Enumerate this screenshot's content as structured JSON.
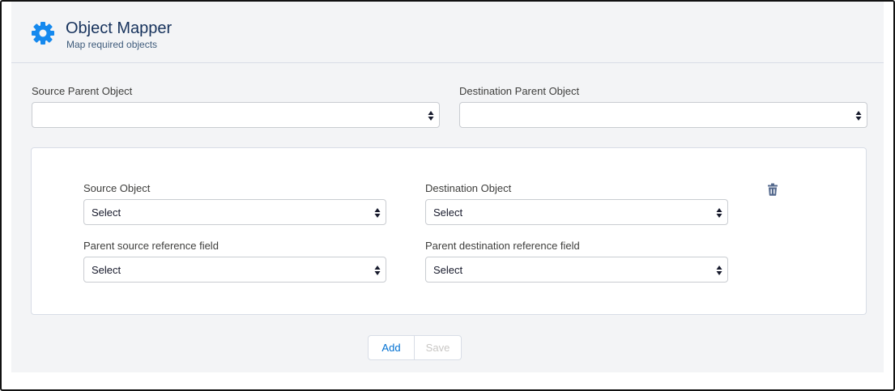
{
  "header": {
    "title": "Object Mapper",
    "subtitle": "Map required objects",
    "icon": "gear-icon",
    "icon_color": "#1589ee"
  },
  "parent_mapping": {
    "source_label": "Source Parent Object",
    "source_value": "",
    "destination_label": "Destination Parent Object",
    "destination_value": ""
  },
  "mapping_row": {
    "source_object_label": "Source Object",
    "source_object_value": "Select",
    "destination_object_label": "Destination Object",
    "destination_object_value": "Select",
    "parent_source_ref_label": "Parent source reference field",
    "parent_source_ref_value": "Select",
    "parent_destination_ref_label": "Parent destination reference field",
    "parent_destination_ref_value": "Select",
    "delete_icon": "trash-icon"
  },
  "actions": {
    "add_label": "Add",
    "save_label": "Save",
    "save_disabled": true
  },
  "colors": {
    "accent": "#0070d2",
    "title": "#16325c",
    "background": "#f3f4f6"
  }
}
